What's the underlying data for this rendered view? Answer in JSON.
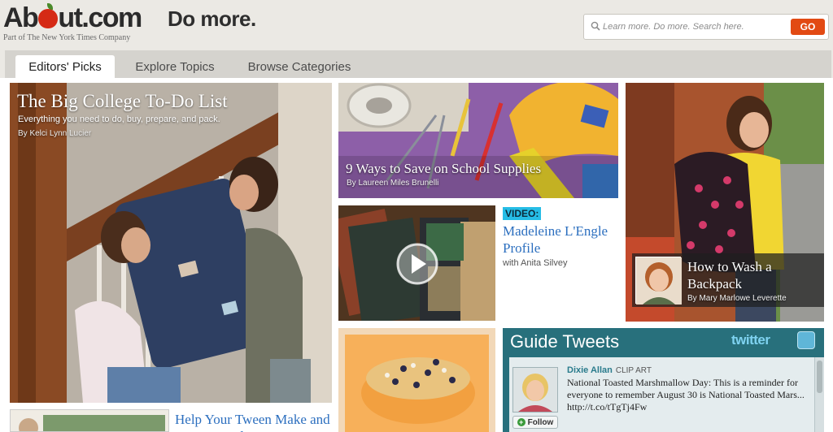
{
  "header": {
    "logo_text": "About.com",
    "logo_subtitle": "Part of The New York Times Company",
    "tagline": "Do more.",
    "search_placeholder": "Learn more. Do more. Search here.",
    "search_button": "GO"
  },
  "tabs": [
    {
      "label": "Editors' Picks",
      "active": true
    },
    {
      "label": "Explore Topics",
      "active": false
    },
    {
      "label": "Browse Categories",
      "active": false
    }
  ],
  "feature": {
    "title": "The Big College To-Do List",
    "subtitle": "Everything you need to do, buy, prepare, and pack.",
    "byline": "By Kelci Lynn Lucier"
  },
  "supplies": {
    "title": "9 Ways to Save on School Supplies",
    "byline": "By Laureen Miles Brunelli"
  },
  "video": {
    "badge": "VIDEO:",
    "title": "Madeleine L'Engle Profile",
    "byline": "with Anita Silvey"
  },
  "backpack": {
    "title": "How to Wash a Backpack",
    "byline": "By Mary Marlowe Leverette"
  },
  "tweets": {
    "title": "Guide Tweets",
    "brand": "twitter",
    "user": "Dixie Allan",
    "category": "CLIP ART",
    "text": "National Toasted Marshmallow Day: This is a reminder for everyone to remember August 30 is National Toasted Mars... http://t.co/tTgTj4Fw",
    "follow_label": "Follow"
  },
  "tween": {
    "title": "Help Your Tween Make and Keep Friends"
  },
  "colors": {
    "accent_orange": "#e24a13",
    "link_blue": "#2c6fbf",
    "tweets_teal": "#28707c",
    "video_badge": "#26bde6"
  }
}
